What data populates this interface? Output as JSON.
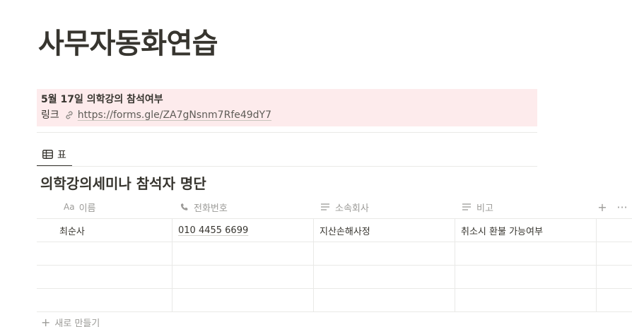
{
  "page": {
    "title": "사무자동화연습"
  },
  "callout": {
    "title": "5월 17일 의학강의 참석여부",
    "link_label": "링크",
    "url": "https://forms.gle/ZA7gNsnm7Rfe49dY7"
  },
  "view_tab": {
    "label": "표",
    "icon": "table-icon"
  },
  "database": {
    "title": "의학강의세미나 참석자 명단",
    "columns": [
      {
        "label": "이름",
        "icon": "text-aa-icon",
        "icon_text": "Aa"
      },
      {
        "label": "전화번호",
        "icon": "phone-icon"
      },
      {
        "label": "소속회사",
        "icon": "text-lines-icon"
      },
      {
        "label": "비고",
        "icon": "text-lines-icon"
      }
    ],
    "header_actions": {
      "add": "+",
      "more": "···"
    },
    "rows": [
      {
        "name": "최순사",
        "phone": "010 4455 6699",
        "company": "지산손해사정",
        "note": "취소시 환불 가능여부"
      },
      {
        "name": "",
        "phone": "",
        "company": "",
        "note": ""
      },
      {
        "name": "",
        "phone": "",
        "company": "",
        "note": ""
      },
      {
        "name": "",
        "phone": "",
        "company": "",
        "note": ""
      }
    ],
    "new_row_label": "새로 만들기"
  },
  "colors": {
    "callout_bg": "#fdebec",
    "text": "#37352f",
    "muted": "#9b9a97",
    "border": "#e9e9e7"
  }
}
